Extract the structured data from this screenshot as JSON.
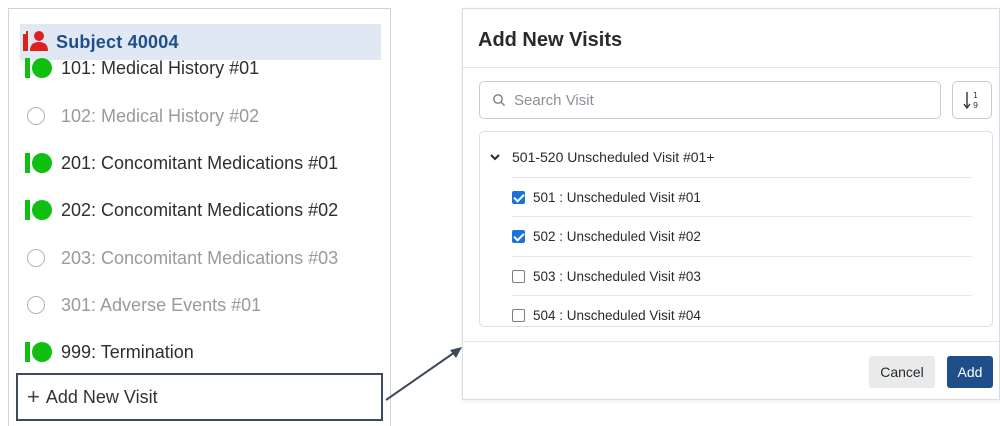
{
  "subject": {
    "title": "Subject 40004",
    "icon": "subject-user-icon"
  },
  "visits": [
    {
      "label": "101: Medical History #01",
      "status": "done"
    },
    {
      "label": "102: Medical History #02",
      "status": "pending"
    },
    {
      "label": "201: Concomitant Medications #01",
      "status": "done"
    },
    {
      "label": "202: Concomitant Medications #02",
      "status": "done"
    },
    {
      "label": "203: Concomitant Medications #03",
      "status": "pending"
    },
    {
      "label": "301: Adverse Events #01",
      "status": "pending"
    },
    {
      "label": "999: Termination",
      "status": "done"
    }
  ],
  "add_visit": {
    "plus": "+",
    "label": "Add New Visit"
  },
  "modal": {
    "title": "Add New Visits",
    "search": {
      "placeholder": "Search Visit",
      "value": ""
    },
    "group": {
      "label": "501-520 Unscheduled Visit #01+",
      "expanded": true,
      "items": [
        {
          "label": "501 : Unscheduled Visit #01",
          "checked": true
        },
        {
          "label": "502 : Unscheduled Visit #02",
          "checked": true
        },
        {
          "label": "503 : Unscheduled Visit #03",
          "checked": false
        },
        {
          "label": "504 : Unscheduled Visit #04",
          "checked": false
        }
      ]
    },
    "cancel_label": "Cancel",
    "add_label": "Add"
  },
  "colors": {
    "done_green": "#10c010",
    "subject_blue": "#1e4f8a",
    "subject_bg": "#dfe8f3",
    "checkbox_blue": "#1a73d9",
    "add_button_bg": "#1e4f8a"
  }
}
